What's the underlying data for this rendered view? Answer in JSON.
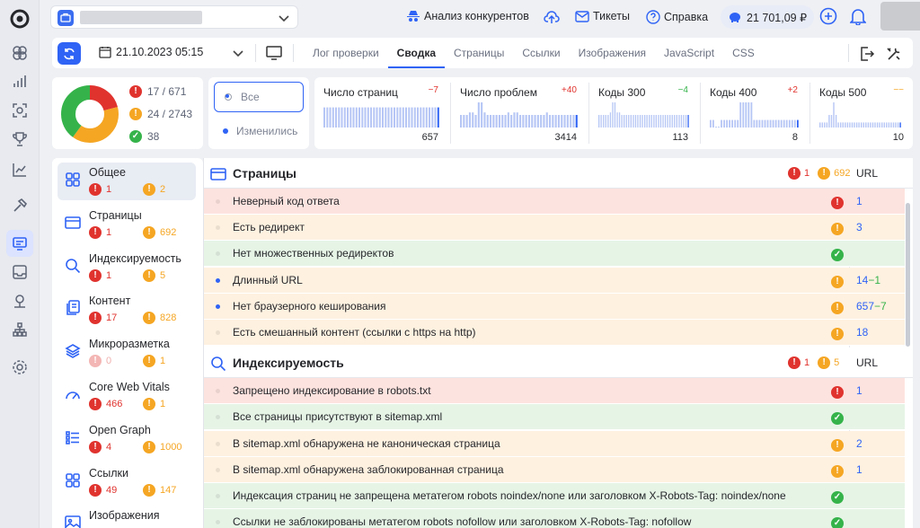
{
  "header": {
    "competitors": "Анализ конкурентов",
    "tickets": "Тикеты",
    "help": "Справка",
    "balance": "21 701,09 ₽"
  },
  "toolbar": {
    "date": "21.10.2023 05:15",
    "tabs": [
      "Лог проверки",
      "Сводка",
      "Страницы",
      "Ссылки",
      "Изображения",
      "JavaScript",
      "CSS"
    ],
    "active_tab": "Сводка"
  },
  "summary": {
    "errors": "17 / 671",
    "warnings": "24 / 2743",
    "ok": "38",
    "donut": {
      "red": 0.21,
      "orange": 0.39,
      "green": 0.4
    }
  },
  "filter": {
    "all": "Все",
    "changed": "Изменились"
  },
  "metrics": [
    {
      "title": "Число страниц",
      "delta": "−7",
      "delta_color": "#e0332e",
      "value": "657",
      "bars": [
        0.8,
        0.8,
        0.8,
        0.8,
        0.8,
        0.8,
        0.8,
        0.8,
        0.8,
        0.8,
        0.8,
        0.8,
        0.8,
        0.8,
        0.8,
        0.8,
        0.8,
        0.8,
        0.8,
        0.8,
        0.8,
        0.8,
        0.8,
        0.8,
        0.8,
        0.8,
        0.8,
        0.8,
        0.8,
        0.8,
        0.8,
        0.8,
        0.8,
        0.8,
        0.8,
        0.8,
        0.8,
        0.8,
        0.8,
        0.8
      ]
    },
    {
      "title": "Число проблем",
      "delta": "+40",
      "delta_color": "#e0332e",
      "value": "3414",
      "bars": [
        0.5,
        0.5,
        0.5,
        0.6,
        0.6,
        0.5,
        1.0,
        1.0,
        0.6,
        0.5,
        0.5,
        0.5,
        0.5,
        0.5,
        0.5,
        0.5,
        0.6,
        0.5,
        0.6,
        0.6,
        0.5,
        0.5,
        0.5,
        0.5,
        0.5,
        0.5,
        0.5,
        0.5,
        0.5,
        0.6,
        0.5,
        0.5,
        0.5,
        0.5,
        0.5,
        0.5,
        0.5,
        0.5,
        0.5,
        0.5
      ]
    },
    {
      "title": "Коды 300",
      "delta": "−4",
      "delta_color": "#35b34a",
      "value": "113",
      "bars": [
        0.5,
        0.5,
        0.5,
        0.5,
        0.5,
        0.6,
        1.0,
        1.0,
        0.6,
        0.6,
        0.5,
        0.5,
        0.5,
        0.5,
        0.5,
        0.5,
        0.5,
        0.5,
        0.5,
        0.5,
        0.5,
        0.5,
        0.5,
        0.5,
        0.5,
        0.5,
        0.5,
        0.5,
        0.5,
        0.5,
        0.5,
        0.5,
        0.5,
        0.5,
        0.5,
        0.5,
        0.5,
        0.5,
        0.5,
        0.5
      ]
    },
    {
      "title": "Коды 400",
      "delta": "+2",
      "delta_color": "#e0332e",
      "value": "8",
      "bars": [
        0.3,
        0.3,
        0.0,
        0.0,
        0.3,
        0.3,
        0.3,
        0.3,
        0.3,
        0.3,
        0.3,
        1.0,
        1.0,
        1.0,
        1.0,
        1.0,
        0.3,
        0.3,
        0.3,
        0.3,
        0.3,
        0.3,
        0.3,
        0.3,
        0.3,
        0.3,
        0.3,
        0.3,
        0.3,
        0.3,
        0.3,
        0.3,
        0.3
      ]
    },
    {
      "title": "Коды 500",
      "delta": "−−",
      "delta_color": "#f5a623",
      "value": "10",
      "bars": [
        0.2,
        0.2,
        0.2,
        0.2,
        0.5,
        0.5,
        1.0,
        0.5,
        0.2,
        0.2,
        0.2,
        0.2,
        0.2,
        0.2,
        0.2,
        0.2,
        0.2,
        0.2,
        0.2,
        0.2,
        0.2,
        0.2,
        0.2,
        0.2,
        0.2,
        0.2,
        0.2,
        0.2,
        0.2,
        0.2,
        0.2,
        0.2,
        0.2,
        0.2,
        0.2,
        0.2
      ]
    }
  ],
  "sidebar": [
    {
      "label": "Общее",
      "err": "1",
      "warn": "2",
      "icon": "grid-icon"
    },
    {
      "label": "Страницы",
      "err": "1",
      "warn": "692",
      "icon": "window-icon"
    },
    {
      "label": "Индексируемость",
      "err": "1",
      "warn": "5",
      "icon": "search-icon"
    },
    {
      "label": "Контент",
      "err": "17",
      "warn": "828",
      "icon": "copy-icon"
    },
    {
      "label": "Микроразметка",
      "err": "0",
      "warn": "1",
      "icon": "layers-icon"
    },
    {
      "label": "Core Web Vitals",
      "err": "466",
      "warn": "1",
      "icon": "gauge-icon"
    },
    {
      "label": "Open Graph",
      "err": "4",
      "warn": "1000",
      "icon": "list-icon"
    },
    {
      "label": "Ссылки",
      "err": "49",
      "warn": "147",
      "icon": "grid-icon"
    },
    {
      "label": "Изображения",
      "err": "",
      "warn": "",
      "icon": "image-icon"
    }
  ],
  "sections": [
    {
      "title": "Страницы",
      "err": "1",
      "warn": "692",
      "url_col": "URL",
      "rows": [
        {
          "text": "Неверный код ответа",
          "status": "red",
          "url": "1",
          "delta": ""
        },
        {
          "text": "Есть редирект",
          "status": "orange",
          "url": "3",
          "delta": ""
        },
        {
          "text": "Нет множественных редиректов",
          "status": "green",
          "url": "",
          "delta": ""
        },
        {
          "text": "Длинный URL",
          "status": "orange",
          "url": "14",
          "delta": "−1"
        },
        {
          "text": "Нет браузерного кеширования",
          "status": "orange",
          "url": "657",
          "delta": "−7"
        },
        {
          "text": "Есть смешанный контент (ссылки с https на http)",
          "status": "orange",
          "url": "18",
          "delta": ""
        }
      ]
    },
    {
      "title": "Индексируемость",
      "err": "1",
      "warn": "5",
      "url_col": "URL",
      "rows": [
        {
          "text": "Запрещено индексирование в robots.txt",
          "status": "red",
          "url": "1",
          "delta": ""
        },
        {
          "text": "Все страницы присутствуют в sitemap.xml",
          "status": "green",
          "url": "",
          "delta": ""
        },
        {
          "text": "В sitemap.xml обнаружена не каноническая страница",
          "status": "orange",
          "url": "2",
          "delta": ""
        },
        {
          "text": "В sitemap.xml обнаружена заблокированная страница",
          "status": "orange",
          "url": "1",
          "delta": ""
        },
        {
          "text": "Индексация страниц не запрещена метатегом robots noindex/none или заголовком X-Robots-Tag: noindex/none",
          "status": "green",
          "url": "",
          "delta": ""
        },
        {
          "text": "Ссылки не заблокированы метатегом robots nofollow или заголовком X-Robots-Tag: nofollow",
          "status": "green",
          "url": "",
          "delta": ""
        }
      ]
    }
  ]
}
